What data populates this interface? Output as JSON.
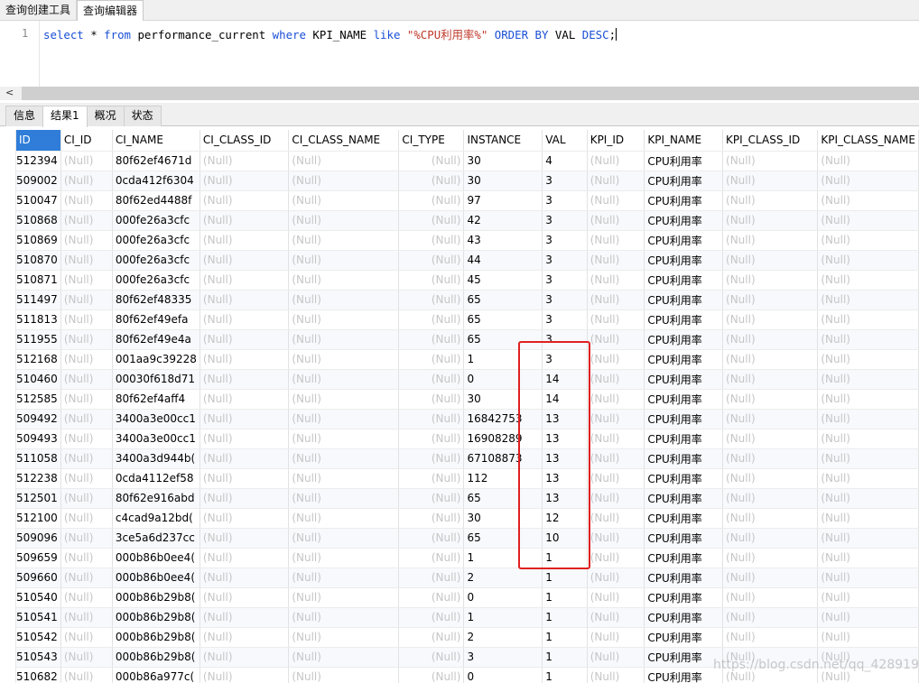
{
  "tabs": [
    "查询创建工具",
    "查询编辑器"
  ],
  "editor": {
    "line_number": "1",
    "tokens": [
      {
        "t": "select",
        "c": "kw"
      },
      {
        "t": " * ",
        "c": ""
      },
      {
        "t": "from",
        "c": "kw"
      },
      {
        "t": " performance_current ",
        "c": ""
      },
      {
        "t": "where",
        "c": "kw"
      },
      {
        "t": " KPI_NAME ",
        "c": ""
      },
      {
        "t": "like",
        "c": "kw"
      },
      {
        "t": " ",
        "c": ""
      },
      {
        "t": "\"%CPU利用率%\"",
        "c": "str"
      },
      {
        "t": " ",
        "c": ""
      },
      {
        "t": "ORDER BY",
        "c": "kw"
      },
      {
        "t": " VAL ",
        "c": ""
      },
      {
        "t": "DESC",
        "c": "kw"
      },
      {
        "t": ";",
        "c": ""
      }
    ]
  },
  "scroll_left_symbol": "<",
  "result_tabs": [
    "信息",
    "结果1",
    "概况",
    "状态"
  ],
  "columns": [
    "ID",
    "CI_ID",
    "CI_NAME",
    "CI_CLASS_ID",
    "CI_CLASS_NAME",
    "CI_TYPE",
    "INSTANCE",
    "VAL",
    "KPI_ID",
    "KPI_NAME",
    "KPI_CLASS_ID",
    "KPI_CLASS_NAME"
  ],
  "null_text": "(Null)",
  "kpi_name": "CPU利用率",
  "rows": [
    {
      "id": "512394",
      "ci_name": "80f62ef4671d",
      "instance": "30",
      "val": "4"
    },
    {
      "id": "509002",
      "ci_name": "0cda412f6304",
      "instance": "30",
      "val": "3"
    },
    {
      "id": "510047",
      "ci_name": "80f62ed4488f",
      "instance": "97",
      "val": "3"
    },
    {
      "id": "510868",
      "ci_name": "000fe26a3cfc",
      "instance": "42",
      "val": "3"
    },
    {
      "id": "510869",
      "ci_name": "000fe26a3cfc",
      "instance": "43",
      "val": "3"
    },
    {
      "id": "510870",
      "ci_name": "000fe26a3cfc",
      "instance": "44",
      "val": "3"
    },
    {
      "id": "510871",
      "ci_name": "000fe26a3cfc",
      "instance": "45",
      "val": "3"
    },
    {
      "id": "511497",
      "ci_name": "80f62ef48335",
      "instance": "65",
      "val": "3"
    },
    {
      "id": "511813",
      "ci_name": "80f62ef49efa",
      "instance": "65",
      "val": "3"
    },
    {
      "id": "511955",
      "ci_name": "80f62ef49e4a",
      "instance": "65",
      "val": "3"
    },
    {
      "id": "512168",
      "ci_name": "001aa9c39228",
      "instance": "1",
      "val": "3"
    },
    {
      "id": "510460",
      "ci_name": "00030f618d71",
      "instance": "0",
      "val": "14"
    },
    {
      "id": "512585",
      "ci_name": "80f62ef4aff4",
      "instance": "30",
      "val": "14"
    },
    {
      "id": "509492",
      "ci_name": "3400a3e00cc1",
      "instance": "16842753",
      "val": "13"
    },
    {
      "id": "509493",
      "ci_name": "3400a3e00cc1",
      "instance": "16908289",
      "val": "13"
    },
    {
      "id": "511058",
      "ci_name": "3400a3d944b(",
      "instance": "67108873",
      "val": "13"
    },
    {
      "id": "512238",
      "ci_name": "0cda4112ef58",
      "instance": "112",
      "val": "13"
    },
    {
      "id": "512501",
      "ci_name": "80f62e916abd",
      "instance": "65",
      "val": "13"
    },
    {
      "id": "512100",
      "ci_name": "c4cad9a12bd(",
      "instance": "30",
      "val": "12"
    },
    {
      "id": "509096",
      "ci_name": "3ce5a6d237cc",
      "instance": "65",
      "val": "10"
    },
    {
      "id": "509659",
      "ci_name": "000b86b0ee4(",
      "instance": "1",
      "val": "1"
    },
    {
      "id": "509660",
      "ci_name": "000b86b0ee4(",
      "instance": "2",
      "val": "1"
    },
    {
      "id": "510540",
      "ci_name": "000b86b29b8(",
      "instance": "0",
      "val": "1"
    },
    {
      "id": "510541",
      "ci_name": "000b86b29b8(",
      "instance": "1",
      "val": "1"
    },
    {
      "id": "510542",
      "ci_name": "000b86b29b8(",
      "instance": "2",
      "val": "1"
    },
    {
      "id": "510543",
      "ci_name": "000b86b29b8(",
      "instance": "3",
      "val": "1"
    },
    {
      "id": "510682",
      "ci_name": "000b86a977c(",
      "instance": "0",
      "val": "1"
    }
  ],
  "watermark": "https://blog.csdn.net/qq_42891975"
}
